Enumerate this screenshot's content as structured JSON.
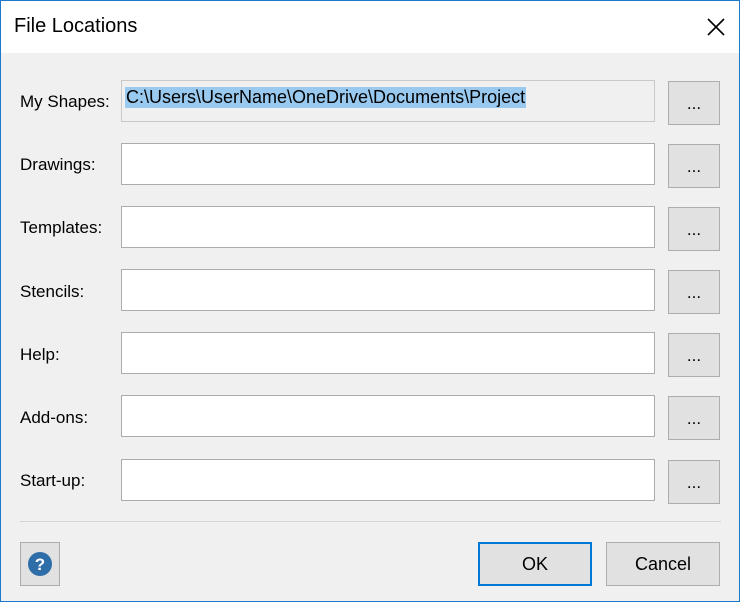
{
  "dialog": {
    "title": "File Locations",
    "close_glyph": "✕"
  },
  "rows": [
    {
      "label": "My Shapes:",
      "value": "C:\\Users\\UserName\\OneDrive\\Documents\\Project",
      "browse_label": "..."
    },
    {
      "label": "Drawings:",
      "value": "",
      "browse_label": "..."
    },
    {
      "label": "Templates:",
      "value": "",
      "browse_label": "..."
    },
    {
      "label": "Stencils:",
      "value": "",
      "browse_label": "..."
    },
    {
      "label": "Help:",
      "value": "",
      "browse_label": "..."
    },
    {
      "label": "Add-ons:",
      "value": "",
      "browse_label": "..."
    },
    {
      "label": "Start-up:",
      "value": "",
      "browse_label": "..."
    }
  ],
  "footer": {
    "ok_label": "OK",
    "cancel_label": "Cancel",
    "help_icon": "question-icon"
  },
  "colors": {
    "accent": "#0078d7",
    "selection": "#99c9ef",
    "help_icon": "#2e6ea8"
  }
}
